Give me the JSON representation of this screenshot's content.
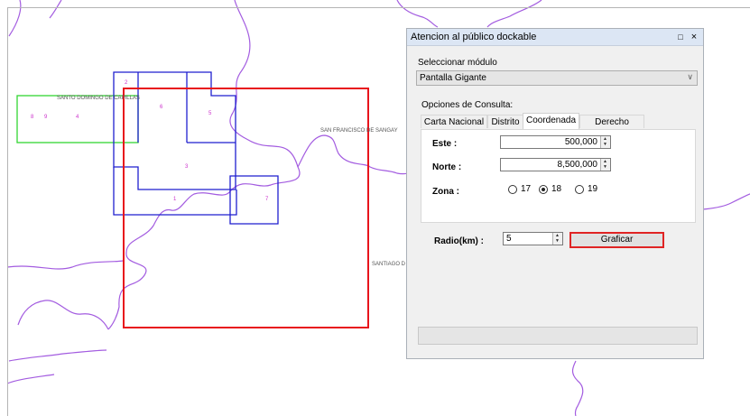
{
  "map": {
    "labels": {
      "santo_domingo": "SANTO DOMINGO DE CAPILLAS",
      "san_francisco": "SAN FRANCISCO DE SANGAY",
      "santiago": "SANTIAGO D"
    },
    "grid_numbers": [
      "8",
      "9",
      "4",
      "2",
      "6",
      "5",
      "3",
      "1",
      "7"
    ],
    "colors": {
      "search_area": "#e8141c",
      "blue_boxes": "#1f1fcf",
      "green_box": "#33d633",
      "boundaries": "#a35ce0",
      "numbers": "#cc33cc"
    }
  },
  "panel": {
    "title": "Atencion al público dockable",
    "restore_icon": "□",
    "close_icon": "×",
    "module_label": "Seleccionar módulo",
    "module_value": "Pantalla Gigante",
    "options_label": "Opciones de Consulta:",
    "tabs": [
      "Carta Nacional",
      "Distrito",
      "Coordenada",
      "Derecho Minero"
    ],
    "active_tab": "Coordenada",
    "este_label": "Este :",
    "este_value": "500,000",
    "norte_label": "Norte :",
    "norte_value": "8,500,000",
    "zona_label": "Zona :",
    "zona_options": [
      "17",
      "18",
      "19"
    ],
    "zona_selected": "18",
    "radio_label": "Radio(km) :",
    "radio_value": "5",
    "graficar_label": "Graficar"
  }
}
